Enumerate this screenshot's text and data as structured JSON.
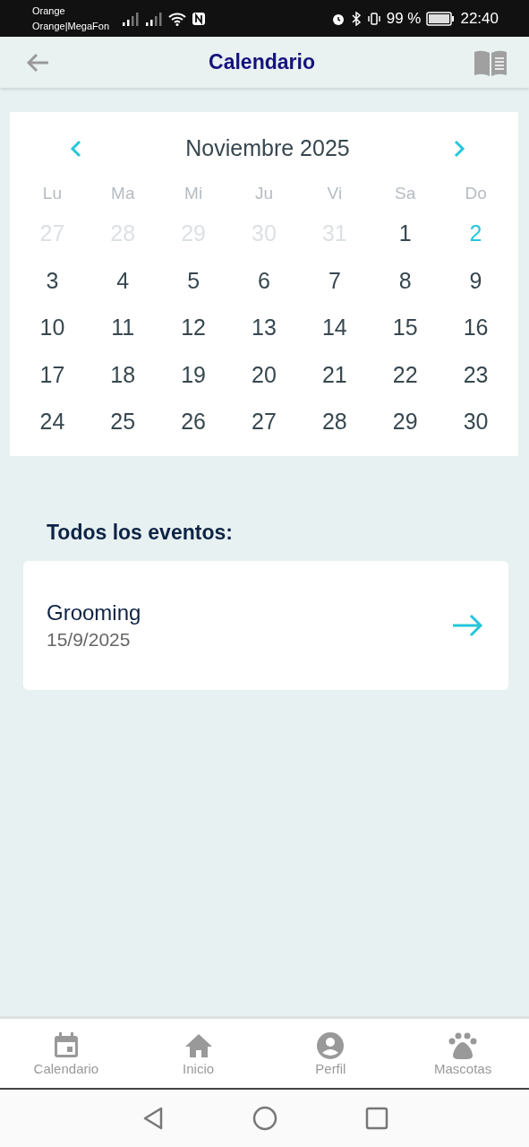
{
  "status_bar": {
    "carrier_1": "Orange",
    "carrier_2": "Orange|MegaFon",
    "battery": "99 %",
    "time": "22:40"
  },
  "header": {
    "title": "Calendario"
  },
  "calendar": {
    "month": "Noviembre 2025",
    "weekdays": [
      "Lu",
      "Ma",
      "Mi",
      "Ju",
      "Vi",
      "Sa",
      "Do"
    ],
    "days": [
      {
        "label": "27",
        "outside": true,
        "today": false
      },
      {
        "label": "28",
        "outside": true,
        "today": false
      },
      {
        "label": "29",
        "outside": true,
        "today": false
      },
      {
        "label": "30",
        "outside": true,
        "today": false
      },
      {
        "label": "31",
        "outside": true,
        "today": false
      },
      {
        "label": "1",
        "outside": false,
        "today": false
      },
      {
        "label": "2",
        "outside": false,
        "today": true
      },
      {
        "label": "3",
        "outside": false,
        "today": false
      },
      {
        "label": "4",
        "outside": false,
        "today": false
      },
      {
        "label": "5",
        "outside": false,
        "today": false
      },
      {
        "label": "6",
        "outside": false,
        "today": false
      },
      {
        "label": "7",
        "outside": false,
        "today": false
      },
      {
        "label": "8",
        "outside": false,
        "today": false
      },
      {
        "label": "9",
        "outside": false,
        "today": false
      },
      {
        "label": "10",
        "outside": false,
        "today": false
      },
      {
        "label": "11",
        "outside": false,
        "today": false
      },
      {
        "label": "12",
        "outside": false,
        "today": false
      },
      {
        "label": "13",
        "outside": false,
        "today": false
      },
      {
        "label": "14",
        "outside": false,
        "today": false
      },
      {
        "label": "15",
        "outside": false,
        "today": false
      },
      {
        "label": "16",
        "outside": false,
        "today": false
      },
      {
        "label": "17",
        "outside": false,
        "today": false
      },
      {
        "label": "18",
        "outside": false,
        "today": false
      },
      {
        "label": "19",
        "outside": false,
        "today": false
      },
      {
        "label": "20",
        "outside": false,
        "today": false
      },
      {
        "label": "21",
        "outside": false,
        "today": false
      },
      {
        "label": "22",
        "outside": false,
        "today": false
      },
      {
        "label": "23",
        "outside": false,
        "today": false
      },
      {
        "label": "24",
        "outside": false,
        "today": false
      },
      {
        "label": "25",
        "outside": false,
        "today": false
      },
      {
        "label": "26",
        "outside": false,
        "today": false
      },
      {
        "label": "27",
        "outside": false,
        "today": false
      },
      {
        "label": "28",
        "outside": false,
        "today": false
      },
      {
        "label": "29",
        "outside": false,
        "today": false
      },
      {
        "label": "30",
        "outside": false,
        "today": false
      }
    ]
  },
  "events": {
    "heading": "Todos los eventos:",
    "items": [
      {
        "title": "Grooming",
        "date": "15/9/2025"
      }
    ]
  },
  "bottom_nav": [
    {
      "label": "Calendario",
      "kind": "calendar"
    },
    {
      "label": "Inicio",
      "kind": "home"
    },
    {
      "label": "Perfil",
      "kind": "profile"
    },
    {
      "label": "Mascotas",
      "kind": "paw"
    }
  ]
}
